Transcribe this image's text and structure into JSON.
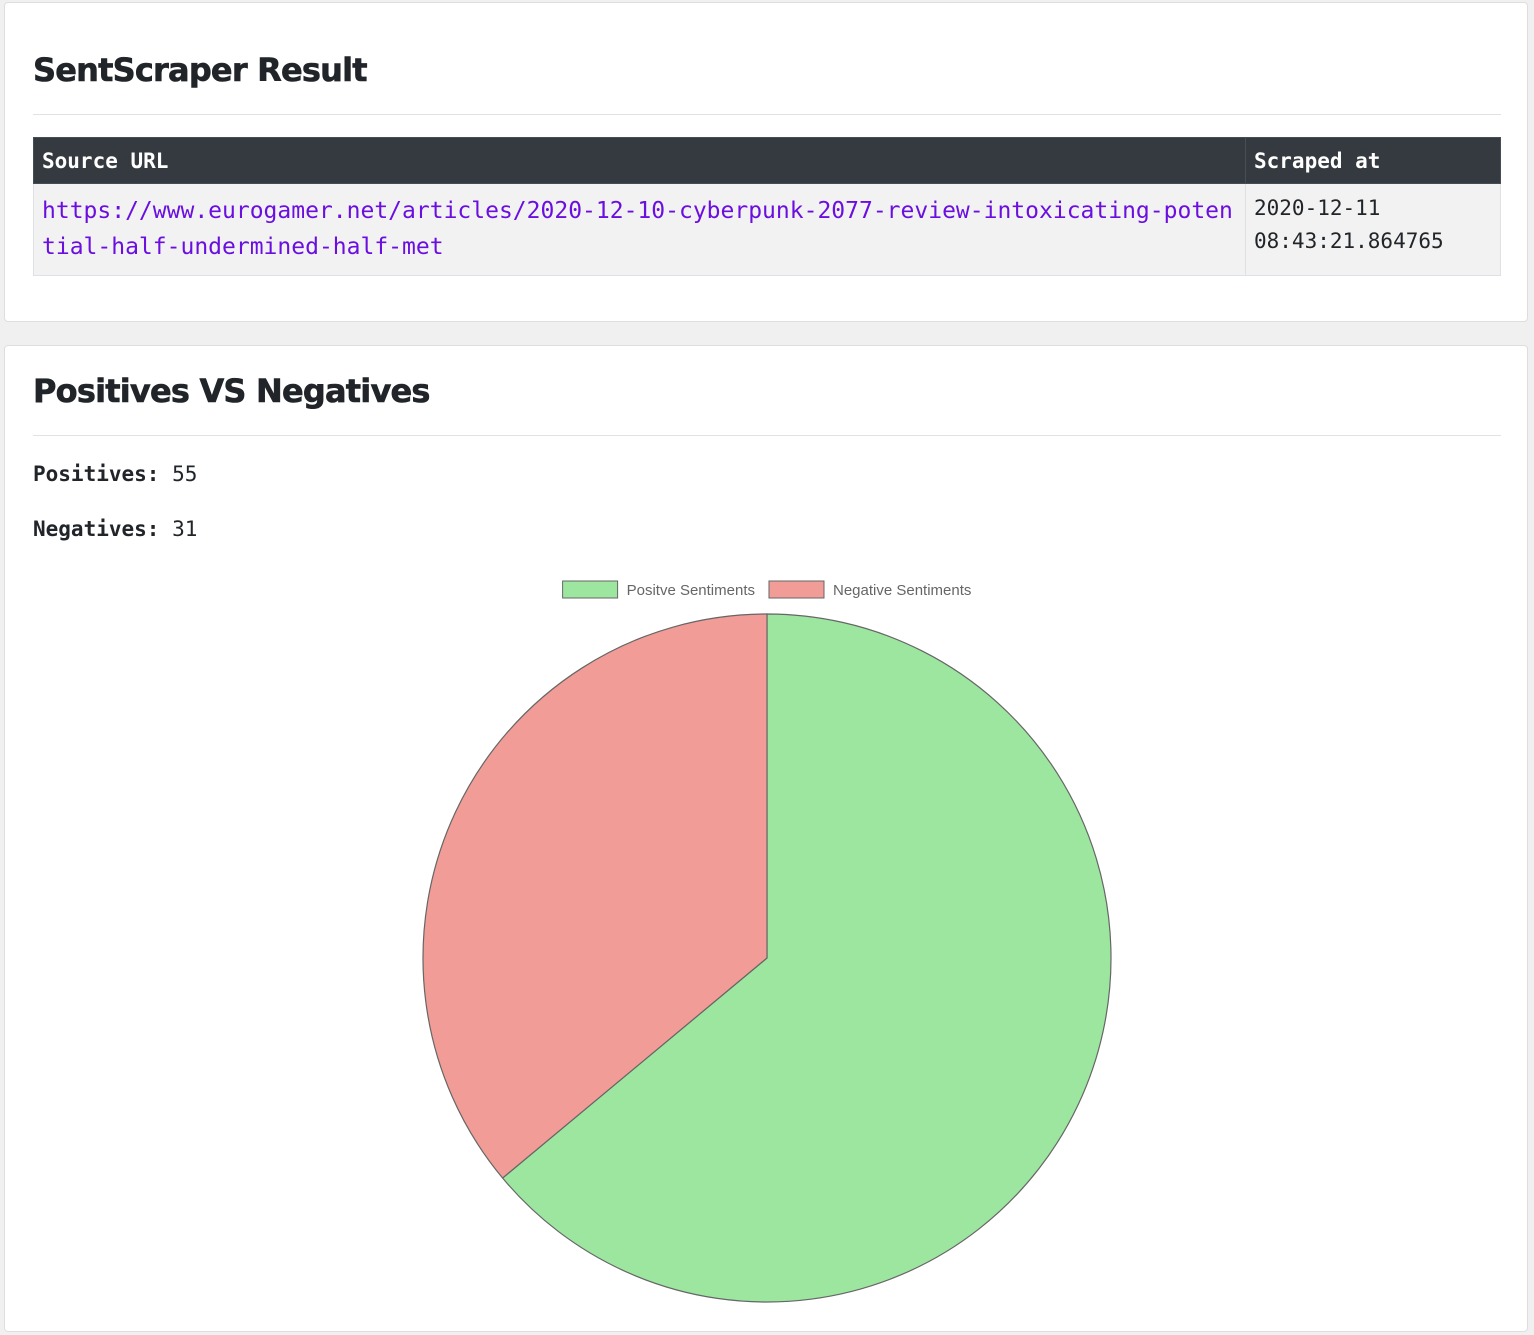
{
  "result": {
    "title": "SentScraper Result",
    "table": {
      "headers": [
        "Source URL",
        "Scraped at"
      ],
      "row": {
        "url": "https://www.eurogamer.net/articles/2020-12-10-cyberpunk-2077-review-intoxicating-potential-half-undermined-half-met",
        "scraped_at_date": "2020-12-11",
        "scraped_at_time": "08:43:21.864765"
      }
    }
  },
  "sentiment": {
    "title": "Positives VS Negatives",
    "positives_label": "Positives:",
    "positives_value": "55",
    "negatives_label": "Negatives:",
    "negatives_value": "31"
  },
  "chart_data": {
    "type": "pie",
    "categories": [
      "Positve Sentiments",
      "Negative Sentiments"
    ],
    "values": [
      55,
      31
    ],
    "colors": [
      "#9de6a0",
      "#f19c96"
    ],
    "border_color": "#666666",
    "legend": "top-center"
  }
}
